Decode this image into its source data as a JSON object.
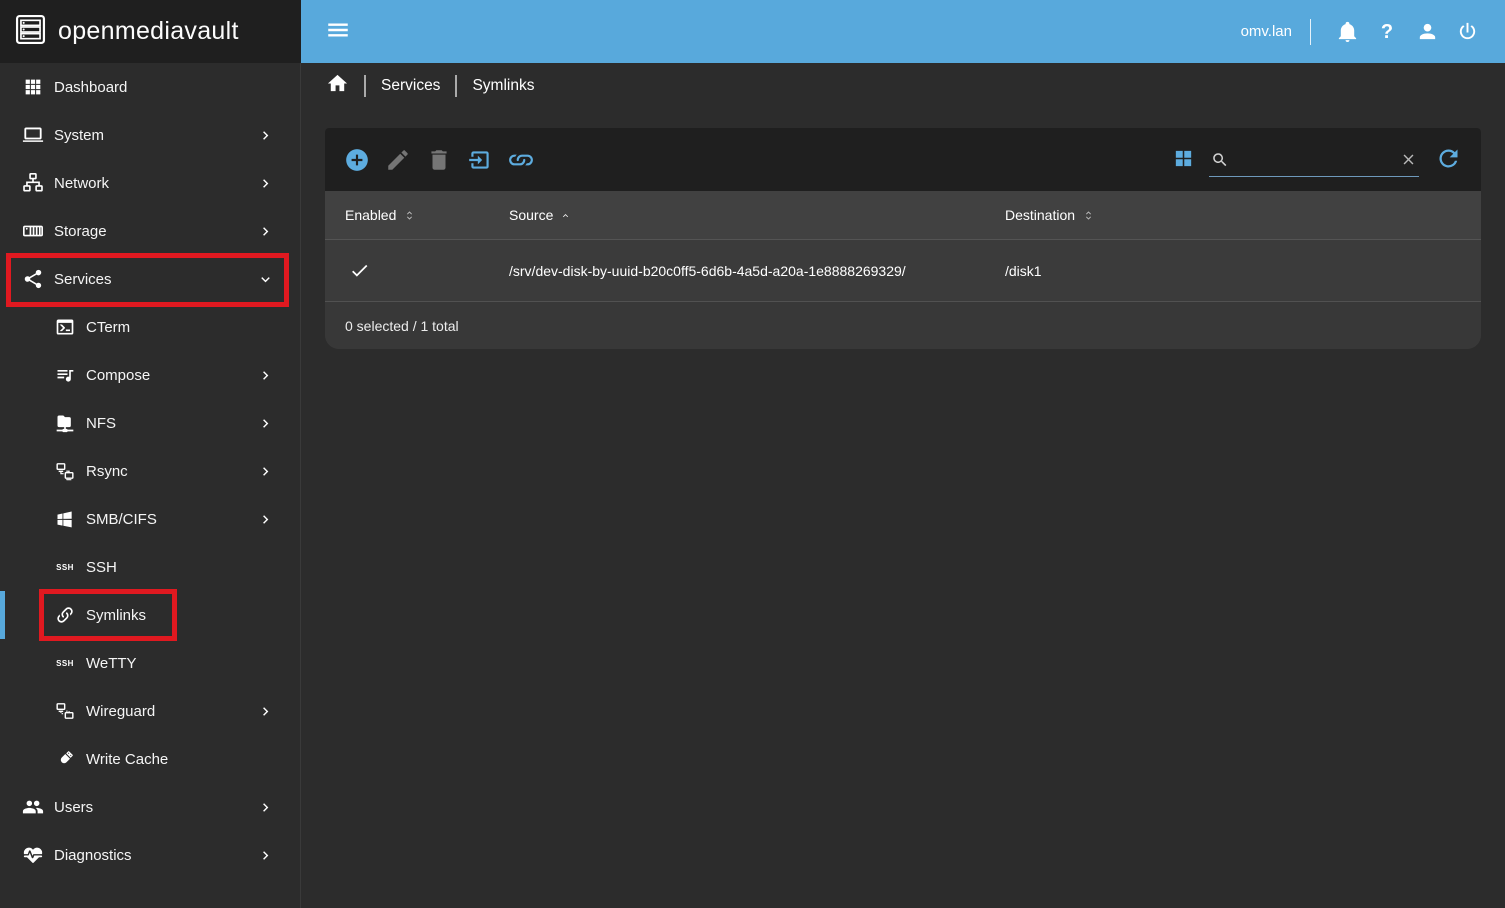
{
  "app": {
    "title": "openmediavault",
    "logo_icon": "omv-logo-icon"
  },
  "topbar": {
    "menu_icon": "hamburger-menu-icon",
    "hostname": "omv.lan",
    "action_icons": [
      {
        "name": "notifications-button",
        "icon": "bell-icon"
      },
      {
        "name": "help-button",
        "icon": "help-icon"
      },
      {
        "name": "user-menu-button",
        "icon": "account-icon"
      },
      {
        "name": "logout-button",
        "icon": "power-icon"
      }
    ]
  },
  "breadcrumb": {
    "home_icon": "home-icon",
    "items": [
      "Services",
      "Symlinks"
    ]
  },
  "sidebar": {
    "items": [
      {
        "label": "Dashboard",
        "icon": "apps-icon",
        "level": 0,
        "chevron": "none",
        "active": false
      },
      {
        "label": "System",
        "icon": "laptop-icon",
        "level": 0,
        "chevron": "right",
        "active": false
      },
      {
        "label": "Network",
        "icon": "lan-icon",
        "level": 0,
        "chevron": "right",
        "active": false
      },
      {
        "label": "Storage",
        "icon": "nas-icon",
        "level": 0,
        "chevron": "right",
        "active": false
      },
      {
        "label": "Services",
        "icon": "share-icon",
        "level": 0,
        "chevron": "down",
        "active": false
      },
      {
        "label": "CTerm",
        "icon": "console-icon",
        "level": 1,
        "chevron": "none",
        "active": false
      },
      {
        "label": "Compose",
        "icon": "playlist-icon",
        "level": 1,
        "chevron": "right",
        "active": false
      },
      {
        "label": "NFS",
        "icon": "folder-network-icon",
        "level": 1,
        "chevron": "right",
        "active": false
      },
      {
        "label": "Rsync",
        "icon": "hosts-sync-icon",
        "level": 1,
        "chevron": "right",
        "active": false
      },
      {
        "label": "SMB/CIFS",
        "icon": "windows-icon",
        "level": 1,
        "chevron": "right",
        "active": false
      },
      {
        "label": "SSH",
        "icon": "ssh-badge-icon",
        "level": 1,
        "chevron": "none",
        "active": false
      },
      {
        "label": "Symlinks",
        "icon": "link-chain-icon",
        "level": 1,
        "chevron": "none",
        "active": true
      },
      {
        "label": "WeTTY",
        "icon": "ssh-badge-icon",
        "level": 1,
        "chevron": "none",
        "active": false
      },
      {
        "label": "Wireguard",
        "icon": "hosts-dashed-icon",
        "level": 1,
        "chevron": "right",
        "active": false
      },
      {
        "label": "Write Cache",
        "icon": "usb-drive-icon",
        "level": 1,
        "chevron": "none",
        "active": false
      },
      {
        "label": "Users",
        "icon": "users-icon",
        "level": 0,
        "chevron": "right",
        "active": false
      },
      {
        "label": "Diagnostics",
        "icon": "heart-pulse-icon",
        "level": 0,
        "chevron": "right",
        "active": false
      }
    ]
  },
  "panel": {
    "toolbar": {
      "left_buttons": [
        {
          "name": "add-button",
          "icon": "plus-circle-icon",
          "state": "enabled"
        },
        {
          "name": "edit-button",
          "icon": "pencil-icon",
          "state": "disabled"
        },
        {
          "name": "delete-button",
          "icon": "trash-icon",
          "state": "disabled"
        },
        {
          "name": "import-button",
          "icon": "import-icon",
          "state": "enabled"
        },
        {
          "name": "create-link-button",
          "icon": "link-icon",
          "state": "enabled"
        }
      ],
      "columns_icon": "table-columns-icon",
      "search": {
        "icon": "magnify-icon",
        "value": "",
        "placeholder": "",
        "clear_icon": "close-icon"
      },
      "reload_icon": "reload-icon"
    },
    "table": {
      "columns": [
        {
          "label": "Enabled",
          "key": "enabled",
          "sort": "sortable"
        },
        {
          "label": "Source",
          "key": "source",
          "sort": "asc"
        },
        {
          "label": "Destination",
          "key": "destination",
          "sort": "sortable"
        }
      ],
      "rows": [
        {
          "enabled": true,
          "enabled_icon": "check-icon",
          "source": "/srv/dev-disk-by-uuid-b20c0ff5-6d6b-4a5d-a20a-1e8888269329/",
          "destination": "/disk1"
        }
      ],
      "footer": "0 selected / 1 total"
    }
  },
  "colors": {
    "topbar_blue": "#58a9dc",
    "accent_blue": "#5dacdf",
    "annotation_red": "#e01920",
    "panel_toolbar": "#1f1f1f",
    "sidebar_bg": "#2c2c2c"
  }
}
